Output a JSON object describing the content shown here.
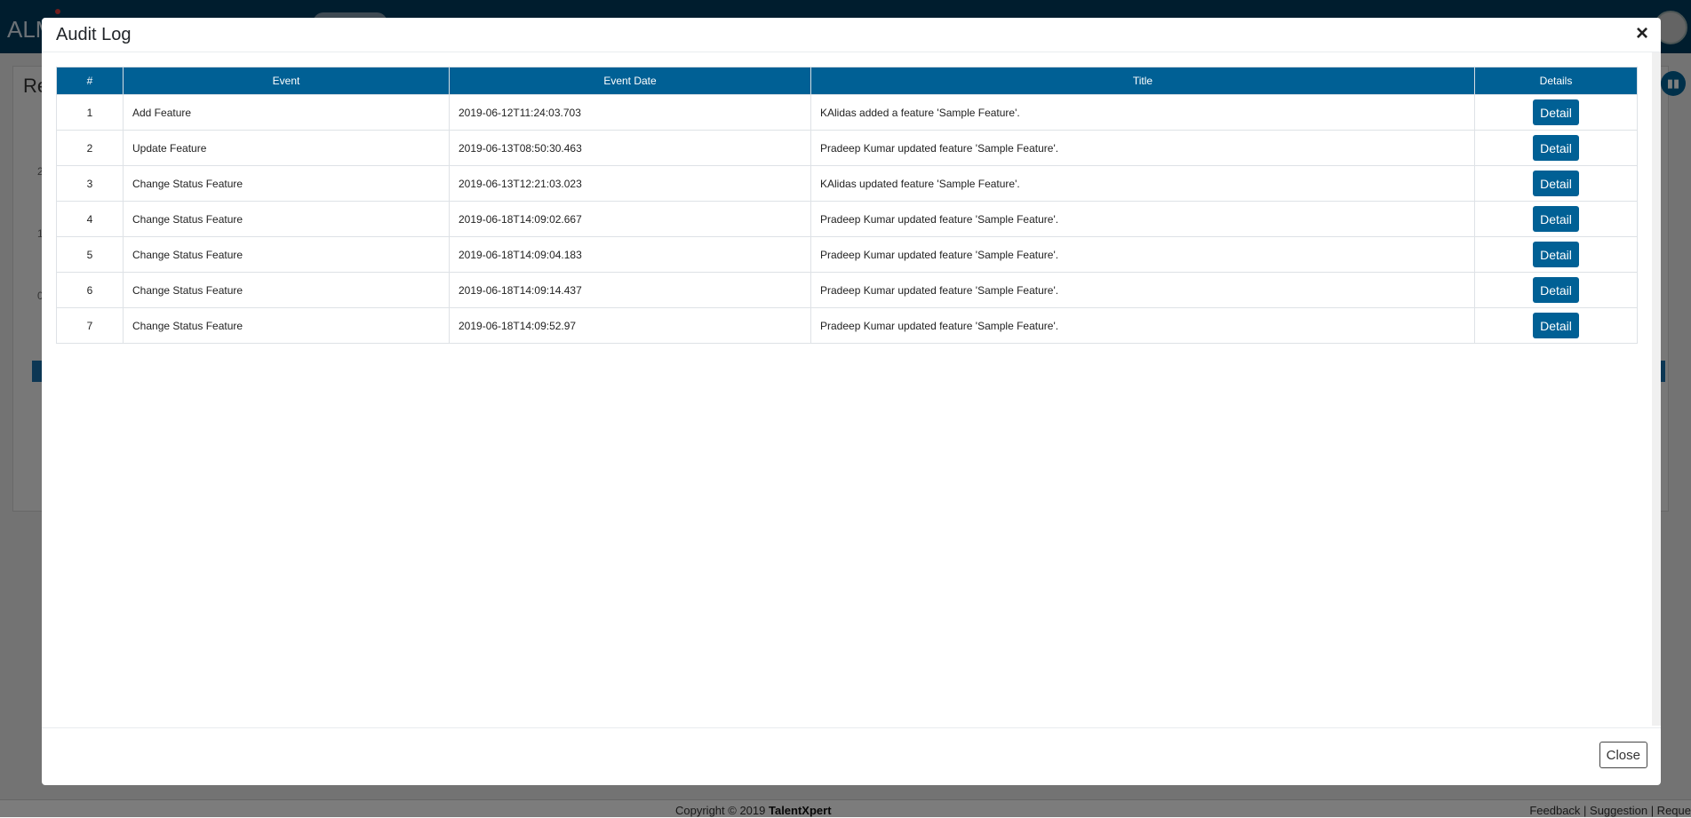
{
  "app": {
    "brand": "ALM",
    "page_heading": "Re",
    "bg_ticks": [
      "2",
      "1",
      "0"
    ]
  },
  "modal": {
    "title": "Audit Log",
    "close_icon": "×",
    "close_label": "Close",
    "columns": {
      "num": "#",
      "event": "Event",
      "event_date": "Event Date",
      "title": "Title",
      "details": "Details"
    },
    "rows": [
      {
        "num": "1",
        "event": "Add Feature",
        "date": "2019-06-12T11:24:03.703",
        "title": "KAlidas added a feature 'Sample Feature'.",
        "action": "Detail"
      },
      {
        "num": "2",
        "event": "Update Feature",
        "date": "2019-06-13T08:50:30.463",
        "title": "Pradeep Kumar updated feature 'Sample Feature'.",
        "action": "Detail"
      },
      {
        "num": "3",
        "event": "Change Status Feature",
        "date": "2019-06-13T12:21:03.023",
        "title": "KAlidas updated feature 'Sample Feature'.",
        "action": "Detail"
      },
      {
        "num": "4",
        "event": "Change Status Feature",
        "date": "2019-06-18T14:09:02.667",
        "title": "Pradeep Kumar updated feature 'Sample Feature'.",
        "action": "Detail"
      },
      {
        "num": "5",
        "event": "Change Status Feature",
        "date": "2019-06-18T14:09:04.183",
        "title": "Pradeep Kumar updated feature 'Sample Feature'.",
        "action": "Detail"
      },
      {
        "num": "6",
        "event": "Change Status Feature",
        "date": "2019-06-18T14:09:14.437",
        "title": "Pradeep Kumar updated feature 'Sample Feature'.",
        "action": "Detail"
      },
      {
        "num": "7",
        "event": "Change Status Feature",
        "date": "2019-06-18T14:09:52.97",
        "title": "Pradeep Kumar updated feature 'Sample Feature'.",
        "action": "Detail"
      }
    ]
  },
  "footer": {
    "copyright": "Copyright © 2019",
    "company": "TalentXpert",
    "links": "Feedback | Suggestion | Reque"
  },
  "colors": {
    "header_blue": "#006095",
    "topbar": "#003a5c"
  },
  "icons": {
    "chart": "bar-chart-icon",
    "user": "user-avatar-icon",
    "close": "close-icon"
  }
}
